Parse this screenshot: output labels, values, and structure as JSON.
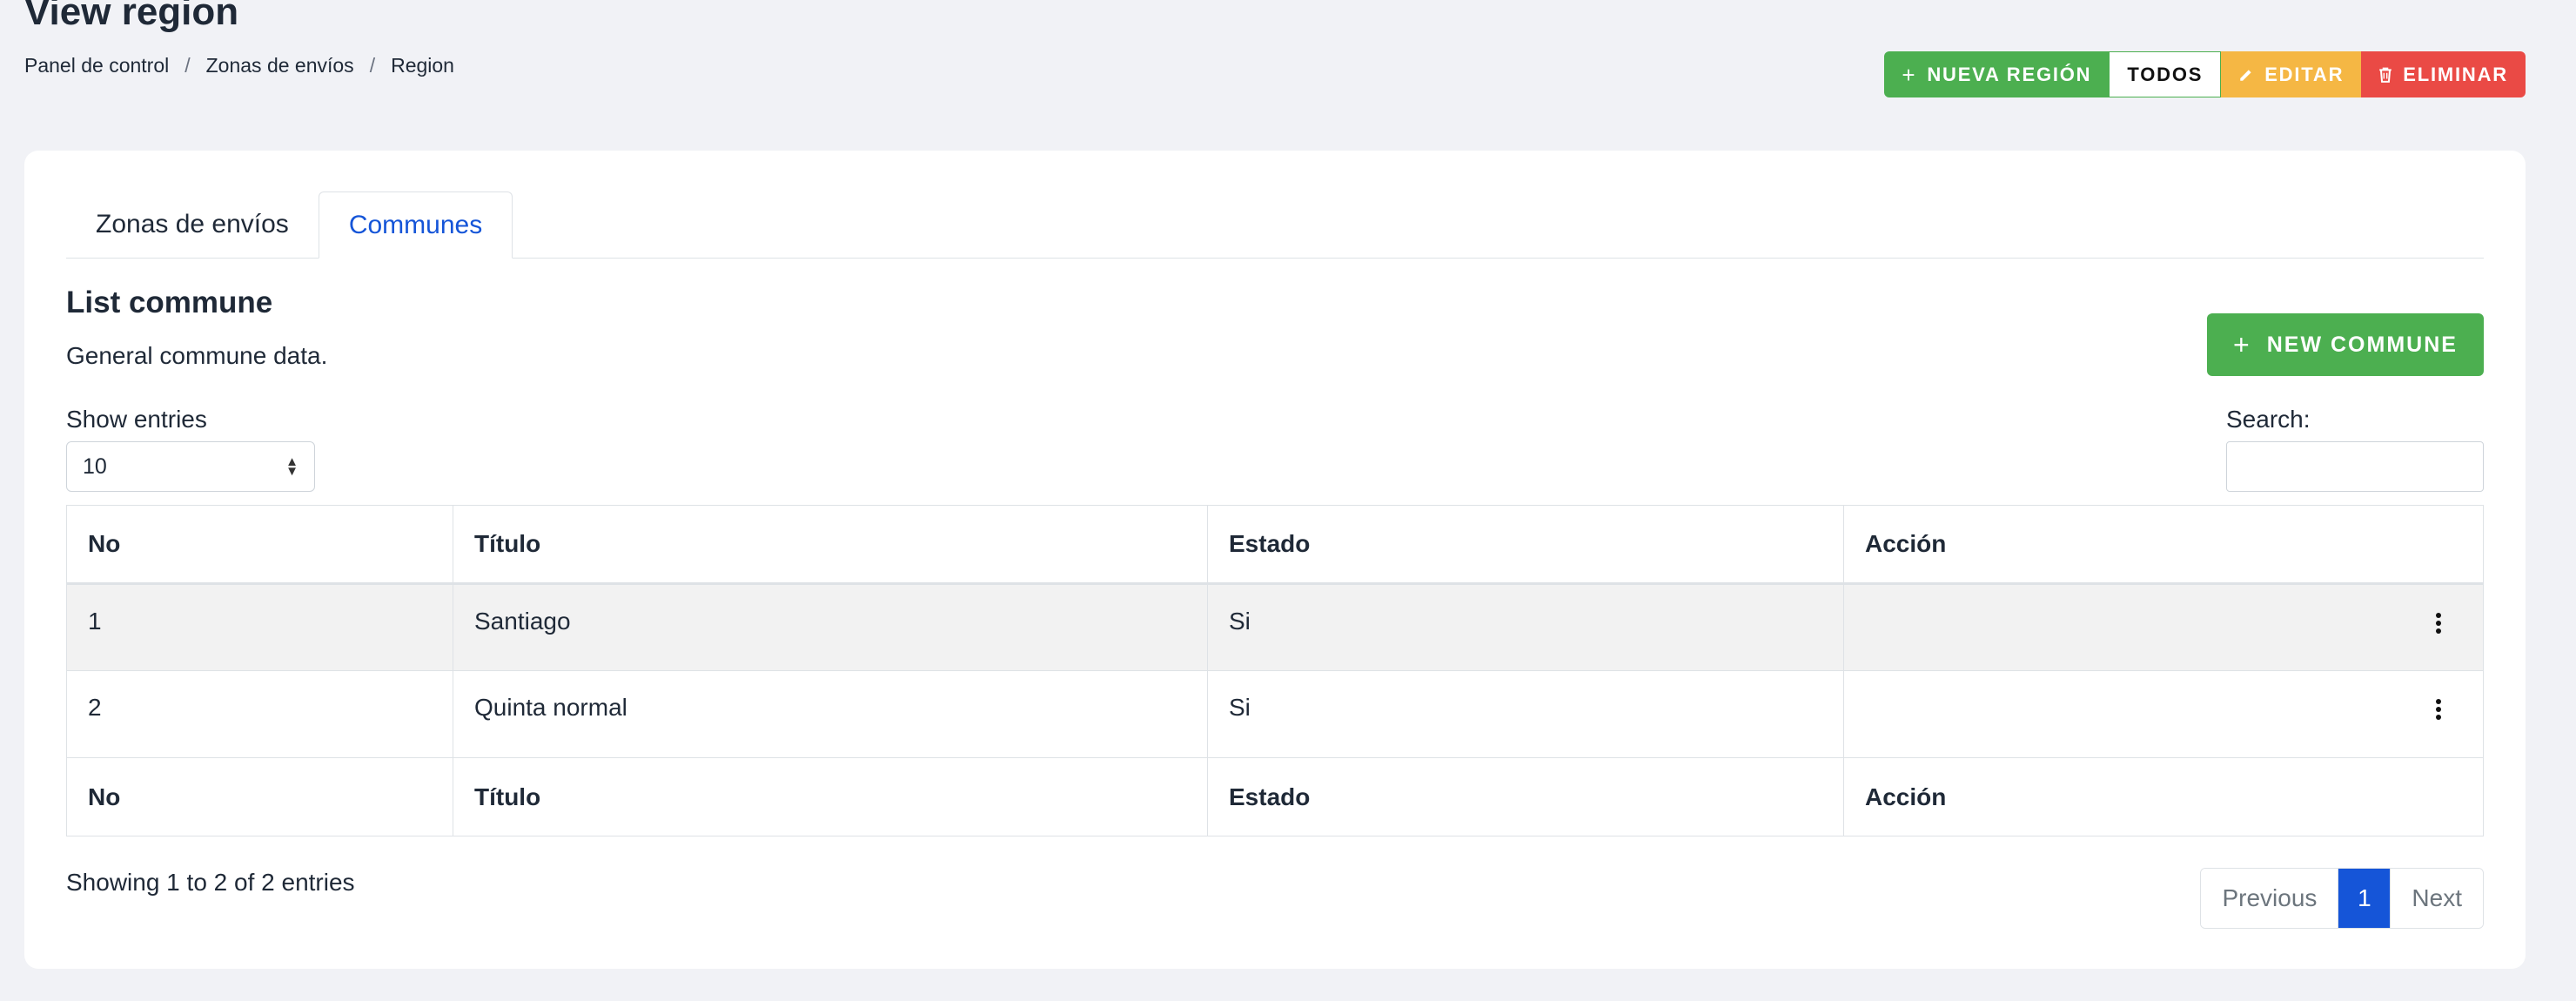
{
  "page": {
    "title": "View region"
  },
  "breadcrumb": [
    "Panel de control",
    "Zonas de envíos",
    "Region"
  ],
  "breadcrumb_separator": "/",
  "actions": {
    "new_region": "NUEVA REGIÓN",
    "all": "TODOS",
    "edit": "EDITAR",
    "delete": "ELIMINAR"
  },
  "tabs": [
    {
      "label": "Zonas de envíos",
      "active": false
    },
    {
      "label": "Communes",
      "active": true
    }
  ],
  "section": {
    "title": "List commune",
    "subtitle": "General commune data.",
    "new_button": "NEW COMMUNE"
  },
  "controls": {
    "show_entries_label": "Show entries",
    "entries_value": "10",
    "search_label": "Search:",
    "search_value": ""
  },
  "table": {
    "columns": [
      "No",
      "Título",
      "Estado",
      "Acción"
    ],
    "rows": [
      {
        "no": "1",
        "title": "Santiago",
        "status": "Si"
      },
      {
        "no": "2",
        "title": "Quinta normal",
        "status": "Si"
      }
    ]
  },
  "footer": {
    "info": "Showing 1 to 2 of 2 entries",
    "previous": "Previous",
    "current_page": "1",
    "next": "Next"
  },
  "colors": {
    "green": "#4caf50",
    "yellow": "#f5b744",
    "red": "#ea4a45",
    "primary": "#1555d8"
  },
  "icons": {
    "new_region": "plus-icon",
    "edit": "pencil-icon",
    "delete": "trash-icon",
    "new_commune": "plus-icon",
    "row_action": "kebab-menu-icon",
    "select": "sort-arrows-icon"
  }
}
